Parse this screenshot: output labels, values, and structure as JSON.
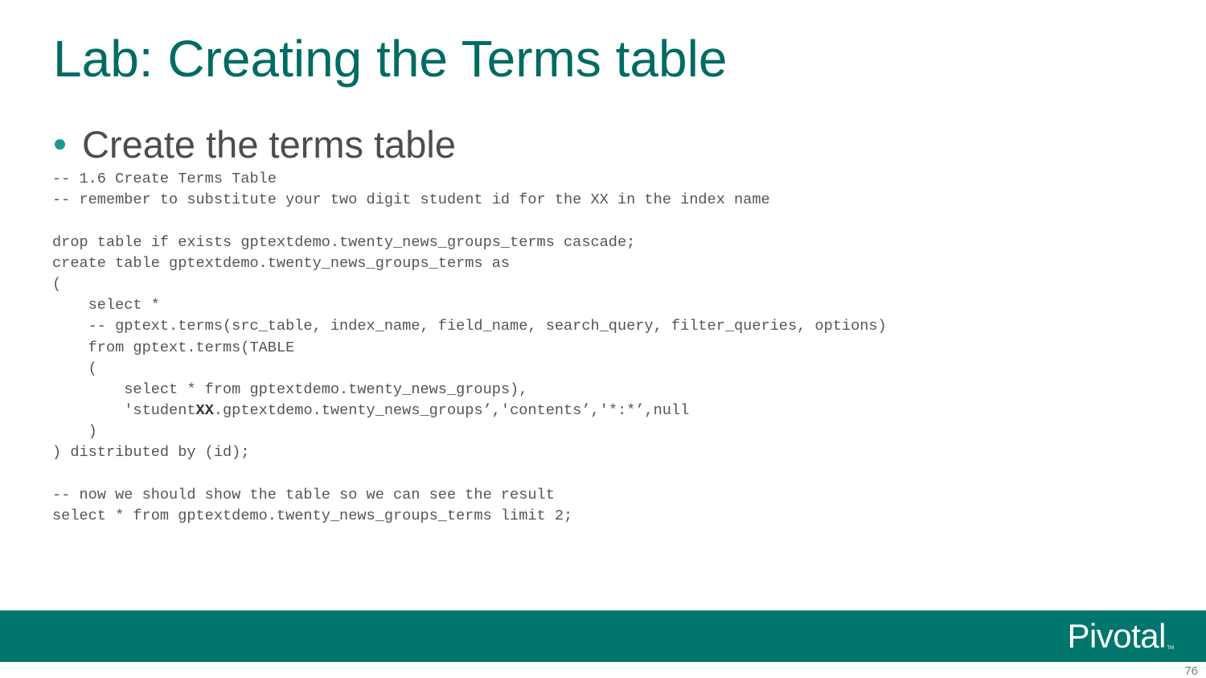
{
  "slide": {
    "title": "Lab: Creating the Terms table",
    "bullet": "Create the terms table",
    "page_number": "76"
  },
  "code": {
    "lines": [
      "-- 1.6 Create Terms Table",
      "-- remember to substitute your two digit student id for the XX in the index name",
      "",
      "drop table if exists gptextdemo.twenty_news_groups_terms cascade;",
      "create table gptextdemo.twenty_news_groups_terms as",
      "(",
      "    select *",
      "    -- gptext.terms(src_table, index_name, field_name, search_query, filter_queries, options)",
      "    from gptext.terms(TABLE",
      "    (",
      "        select * from gptextdemo.twenty_news_groups),",
      "        'student",
      "    )",
      ") distributed by (id);",
      "",
      "-- now we should show the table so we can see the result",
      "select * from gptextdemo.twenty_news_groups_terms limit 2;"
    ],
    "line_11_bold": "XX",
    "line_11_rest": ".gptextdemo.twenty_news_groups’,'contents’,'*:*’,null"
  },
  "footer": {
    "brand": "Pivotal",
    "trademark": "TM",
    "bar_color": "#00766d"
  },
  "colors": {
    "title": "#006b63",
    "bullet_dot": "#1d9a8e",
    "body_text": "#4d4d4d",
    "code_text": "#555555"
  }
}
